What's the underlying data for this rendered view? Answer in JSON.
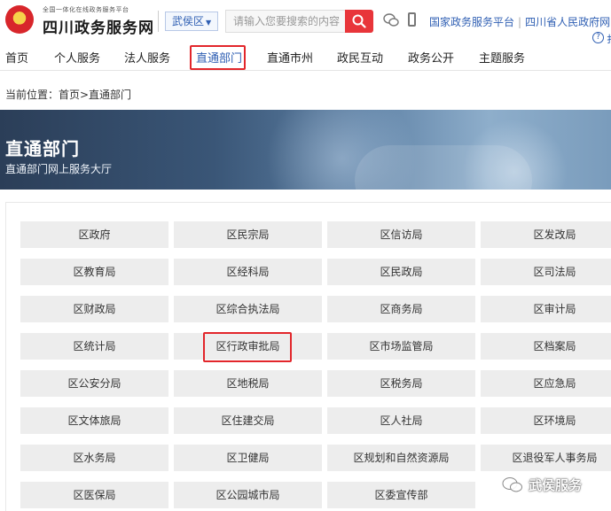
{
  "header": {
    "site_subtitle": "全国一体化在线政务服务平台",
    "site_title": "四川政务服务网",
    "region": "武侯区",
    "search_placeholder": "请输入您要搜索的内容",
    "links": [
      "国家政务服务平台",
      "四川省人民政府网"
    ],
    "help_fragment": "扌"
  },
  "nav": {
    "items": [
      "首页",
      "个人服务",
      "法人服务",
      "直通部门",
      "直通市州",
      "政民互动",
      "政务公开",
      "主题服务"
    ],
    "active": "直通部门"
  },
  "breadcrumb": "当前位置：首页>直通部门",
  "banner": {
    "title": "直通部门",
    "subtitle": "直通部门网上服务大厅"
  },
  "departments": [
    "区政府",
    "区民宗局",
    "区信访局",
    "区发改局",
    "区教育局",
    "区经科局",
    "区民政局",
    "区司法局",
    "区财政局",
    "区综合执法局",
    "区商务局",
    "区审计局",
    "区统计局",
    "区行政审批局",
    "区市场监管局",
    "区档案局",
    "区公安分局",
    "区地税局",
    "区税务局",
    "区应急局",
    "区文体旅局",
    "区住建交局",
    "区人社局",
    "区环境局",
    "区水务局",
    "区卫健局",
    "区规划和自然资源局",
    "区退役军人事务局",
    "区医保局",
    "区公园城市局",
    "区委宣传部",
    ""
  ],
  "highlighted_department": "区行政审批局",
  "watermark": "武侯服务",
  "colors": {
    "accent_red": "#e2262b",
    "link_blue": "#2f5fb3",
    "tile_gray": "#ededed"
  }
}
